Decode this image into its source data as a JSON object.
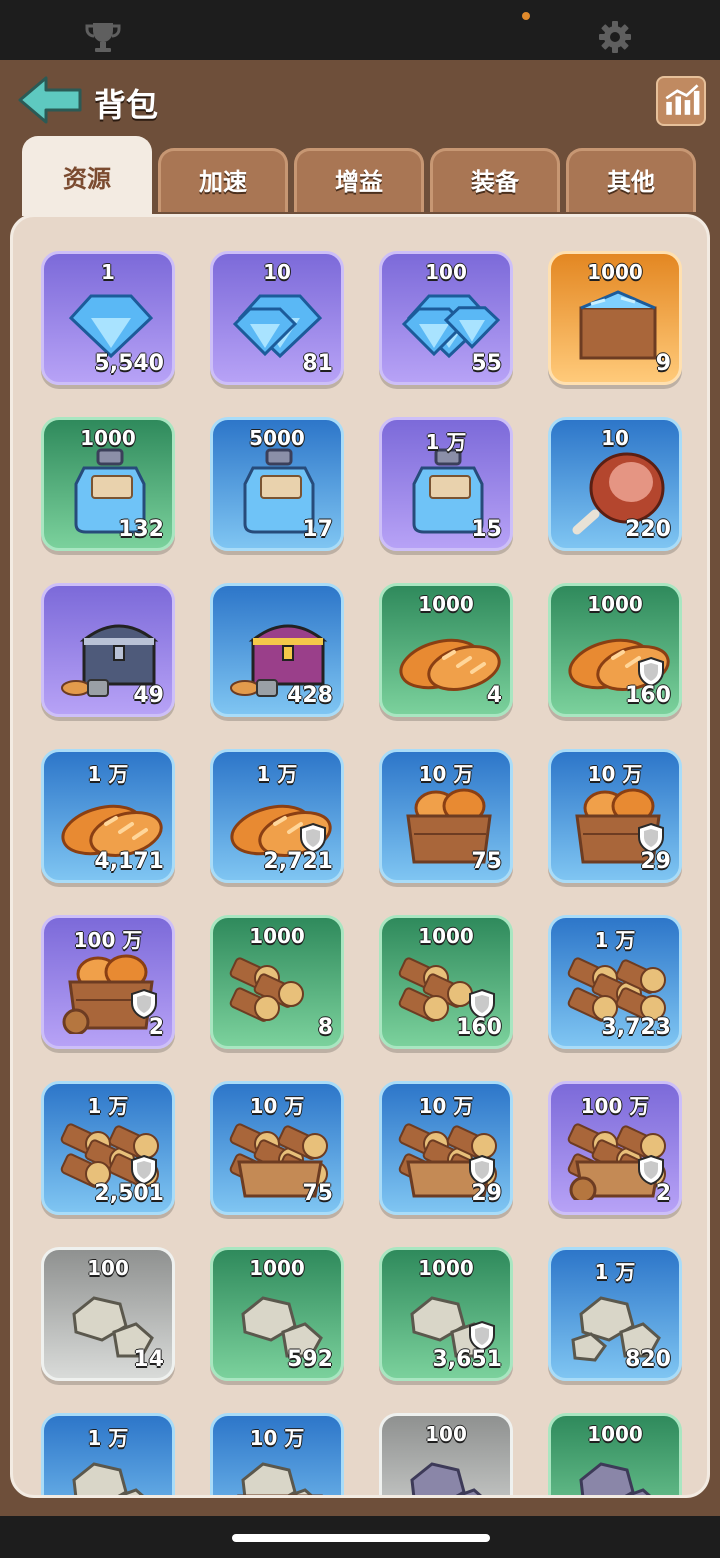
{
  "status_icons": {
    "trophy": "trophy-icon",
    "gear": "gear-icon",
    "dot_color": "#e08a2c"
  },
  "header": {
    "title": "背包",
    "back_icon": "back-arrow-icon",
    "stats_icon": "bar-chart-icon"
  },
  "tabs": [
    {
      "label": "资源",
      "active": true
    },
    {
      "label": "加速",
      "active": false
    },
    {
      "label": "增益",
      "active": false
    },
    {
      "label": "装备",
      "active": false
    },
    {
      "label": "其他",
      "active": false
    }
  ],
  "items": [
    {
      "amount": "1",
      "count": "5,540",
      "rarity": "purple",
      "icon": "gem-icon",
      "locked": false
    },
    {
      "amount": "10",
      "count": "81",
      "rarity": "purple",
      "icon": "gems-icon",
      "locked": false
    },
    {
      "amount": "100",
      "count": "55",
      "rarity": "purple",
      "icon": "gem-pile-icon",
      "locked": false
    },
    {
      "amount": "1000",
      "count": "9",
      "rarity": "orange",
      "icon": "gem-crate-icon",
      "locked": false
    },
    {
      "amount": "1000",
      "count": "132",
      "rarity": "green",
      "icon": "exp-potion-icon",
      "locked": false
    },
    {
      "amount": "5000",
      "count": "17",
      "rarity": "blue",
      "icon": "exp-potion-icon",
      "locked": false
    },
    {
      "amount": "1 万",
      "count": "15",
      "rarity": "purple",
      "icon": "exp-potion-icon",
      "locked": false
    },
    {
      "amount": "10",
      "count": "220",
      "rarity": "blue",
      "icon": "ham-icon",
      "locked": false
    },
    {
      "amount": "",
      "count": "49",
      "rarity": "purple",
      "icon": "resource-chest-icon",
      "locked": false
    },
    {
      "amount": "",
      "count": "428",
      "rarity": "blue",
      "icon": "golden-chest-icon",
      "locked": false
    },
    {
      "amount": "1000",
      "count": "4",
      "rarity": "green",
      "icon": "bread-icon",
      "locked": false
    },
    {
      "amount": "1000",
      "count": "160",
      "rarity": "green",
      "icon": "bread-icon",
      "locked": true
    },
    {
      "amount": "1 万",
      "count": "4,171",
      "rarity": "blue",
      "icon": "bread-icon",
      "locked": false
    },
    {
      "amount": "1 万",
      "count": "2,721",
      "rarity": "blue",
      "icon": "bread-icon",
      "locked": true
    },
    {
      "amount": "10 万",
      "count": "75",
      "rarity": "blue",
      "icon": "bread-crate-icon",
      "locked": false
    },
    {
      "amount": "10 万",
      "count": "29",
      "rarity": "blue",
      "icon": "bread-crate-icon",
      "locked": true
    },
    {
      "amount": "100 万",
      "count": "2",
      "rarity": "purple",
      "icon": "bread-cart-icon",
      "locked": true
    },
    {
      "amount": "1000",
      "count": "8",
      "rarity": "green",
      "icon": "wood-icon",
      "locked": false
    },
    {
      "amount": "1000",
      "count": "160",
      "rarity": "green",
      "icon": "wood-icon",
      "locked": true
    },
    {
      "amount": "1 万",
      "count": "3,723",
      "rarity": "blue",
      "icon": "wood-pile-icon",
      "locked": false
    },
    {
      "amount": "1 万",
      "count": "2,501",
      "rarity": "blue",
      "icon": "wood-pile-icon",
      "locked": true
    },
    {
      "amount": "10 万",
      "count": "75",
      "rarity": "blue",
      "icon": "wood-crate-icon",
      "locked": false
    },
    {
      "amount": "10 万",
      "count": "29",
      "rarity": "blue",
      "icon": "wood-crate-icon",
      "locked": true
    },
    {
      "amount": "100 万",
      "count": "2",
      "rarity": "purple",
      "icon": "wood-cart-icon",
      "locked": true
    },
    {
      "amount": "100",
      "count": "14",
      "rarity": "gray",
      "icon": "stone-icon",
      "locked": false
    },
    {
      "amount": "1000",
      "count": "592",
      "rarity": "green",
      "icon": "stone-icon",
      "locked": false
    },
    {
      "amount": "1000",
      "count": "3,651",
      "rarity": "green",
      "icon": "stone-icon",
      "locked": true
    },
    {
      "amount": "1 万",
      "count": "820",
      "rarity": "blue",
      "icon": "stone-pile-icon",
      "locked": false
    },
    {
      "amount": "1 万",
      "count": "",
      "rarity": "blue",
      "icon": "stone-pile-icon",
      "locked": false
    },
    {
      "amount": "10 万",
      "count": "",
      "rarity": "blue",
      "icon": "stone-crate-icon",
      "locked": false
    },
    {
      "amount": "100",
      "count": "",
      "rarity": "gray",
      "icon": "iron-ore-icon",
      "locked": false
    },
    {
      "amount": "1000",
      "count": "",
      "rarity": "green",
      "icon": "iron-ore-icon",
      "locked": false
    }
  ]
}
